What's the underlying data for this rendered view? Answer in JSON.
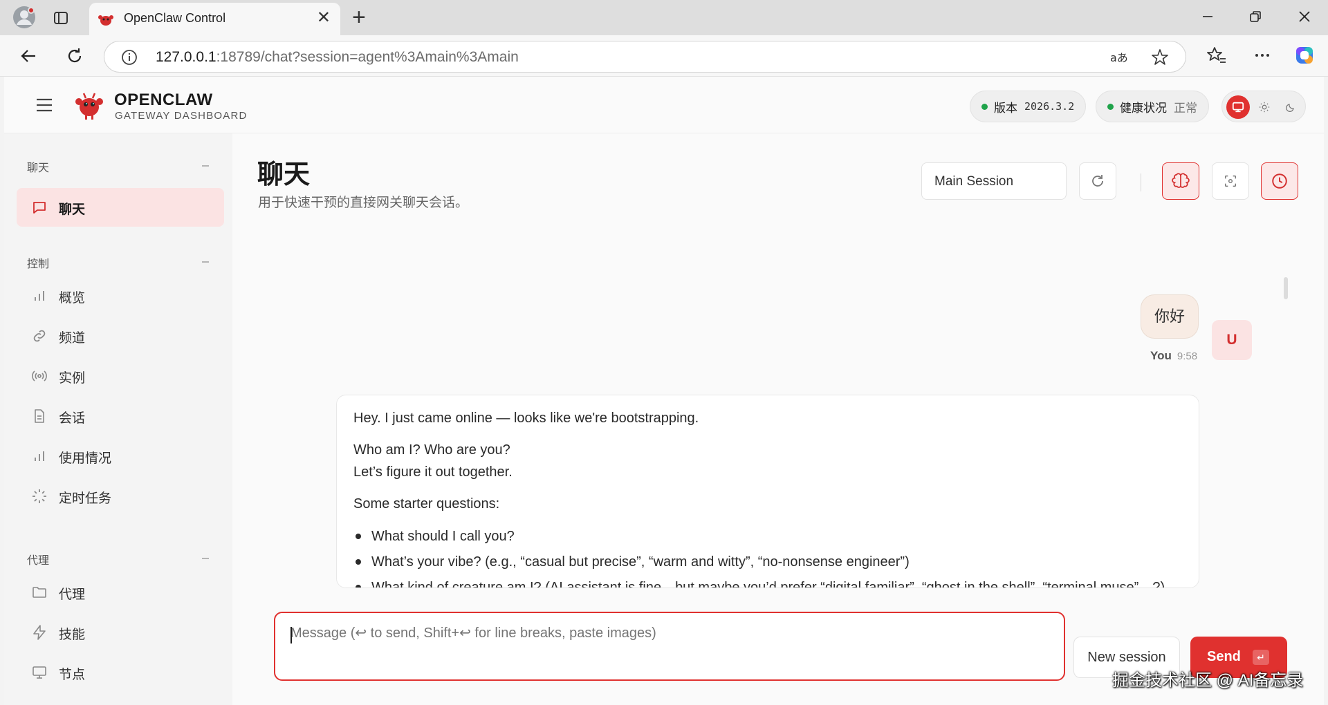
{
  "browser": {
    "tab_title": "OpenClaw Control",
    "tab_close": "✕",
    "new_tab": "+",
    "url_host": "127.0.0.1",
    "url_rest": ":18789/chat?session=agent%3Amain%3Amain"
  },
  "header": {
    "brand_name": "OPENCLAW",
    "brand_sub": "GATEWAY DASHBOARD",
    "version_label": "版本",
    "version_value": "2026.3.2",
    "health_label": "健康状况",
    "health_value": "正常"
  },
  "sidebar": {
    "sections": [
      {
        "title": "聊天",
        "items": [
          {
            "label": "聊天",
            "icon": "message-icon",
            "active": true
          }
        ]
      },
      {
        "title": "控制",
        "items": [
          {
            "label": "概览",
            "icon": "bar-chart-icon"
          },
          {
            "label": "频道",
            "icon": "link-icon"
          },
          {
            "label": "实例",
            "icon": "radio-icon"
          },
          {
            "label": "会话",
            "icon": "file-icon"
          },
          {
            "label": "使用情况",
            "icon": "bar-chart-icon"
          },
          {
            "label": "定时任务",
            "icon": "loader-icon"
          }
        ]
      },
      {
        "title": "代理",
        "items": [
          {
            "label": "代理",
            "icon": "folder-icon"
          },
          {
            "label": "技能",
            "icon": "zap-icon"
          },
          {
            "label": "节点",
            "icon": "monitor-icon"
          }
        ]
      }
    ]
  },
  "main": {
    "title": "聊天",
    "subtitle": "用于快速干预的直接网关聊天会话。",
    "session_select": "Main Session"
  },
  "messages": {
    "user": {
      "text": "你好",
      "avatar": "U",
      "sender": "You",
      "time": "9:58"
    },
    "assistant": {
      "line1": "Hey. I just came online — looks like we're bootstrapping.",
      "line2": "Who am I? Who are you?",
      "line3": "Let’s figure it out together.",
      "line4": "Some starter questions:",
      "bullets": [
        "What should I call you?",
        "What’s your vibe? (e.g., “casual but precise”, “warm and witty”, “no-nonsense engineer”)",
        "What kind of creature am I? (AI assistant is fine—but maybe you’d prefer “digital familiar”, “ghost in the shell”, “terminal muse”…?)"
      ]
    }
  },
  "composer": {
    "placeholder": "Message (↩ to send, Shift+↩ for line breaks, paste images)",
    "new_session": "New session",
    "send": "Send",
    "send_kbd": "↵"
  },
  "watermark": "掘金技术社区 @ AI备忘录",
  "colors": {
    "accent": "#e0312f",
    "health_green": "#1fa34a",
    "active_nav_bg": "#fbe3e3"
  }
}
